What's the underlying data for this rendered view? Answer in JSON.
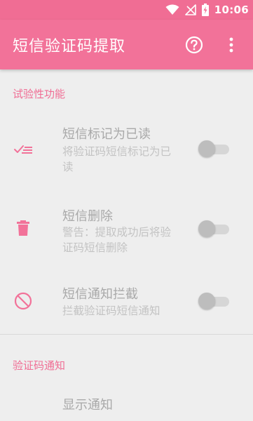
{
  "status_bar": {
    "time": "10:06",
    "icons": [
      "wifi-icon",
      "no-signal-icon",
      "battery-charging-icon"
    ]
  },
  "app_bar": {
    "title": "短信验证码提取",
    "actions": [
      "help-icon",
      "more-vert-icon"
    ]
  },
  "sections": [
    {
      "header": "试验性功能",
      "items": [
        {
          "icon": "mark-read-icon",
          "title": "短信标记为已读",
          "summary": "将验证码短信标记为已读",
          "enabled": false
        },
        {
          "icon": "trash-icon",
          "title": "短信删除",
          "summary": "警告：提取成功后将验证码短信删除",
          "enabled": false
        },
        {
          "icon": "block-icon",
          "title": "短信通知拦截",
          "summary": "拦截验证码短信通知",
          "enabled": false
        }
      ]
    },
    {
      "header": "验证码通知",
      "items": [
        {
          "title": "显示通知"
        }
      ]
    }
  ],
  "colors": {
    "accent": "#f06d94",
    "app_bar": "#f27299",
    "background": "#eeeeee",
    "disabled_text": "#a9a9a9"
  }
}
